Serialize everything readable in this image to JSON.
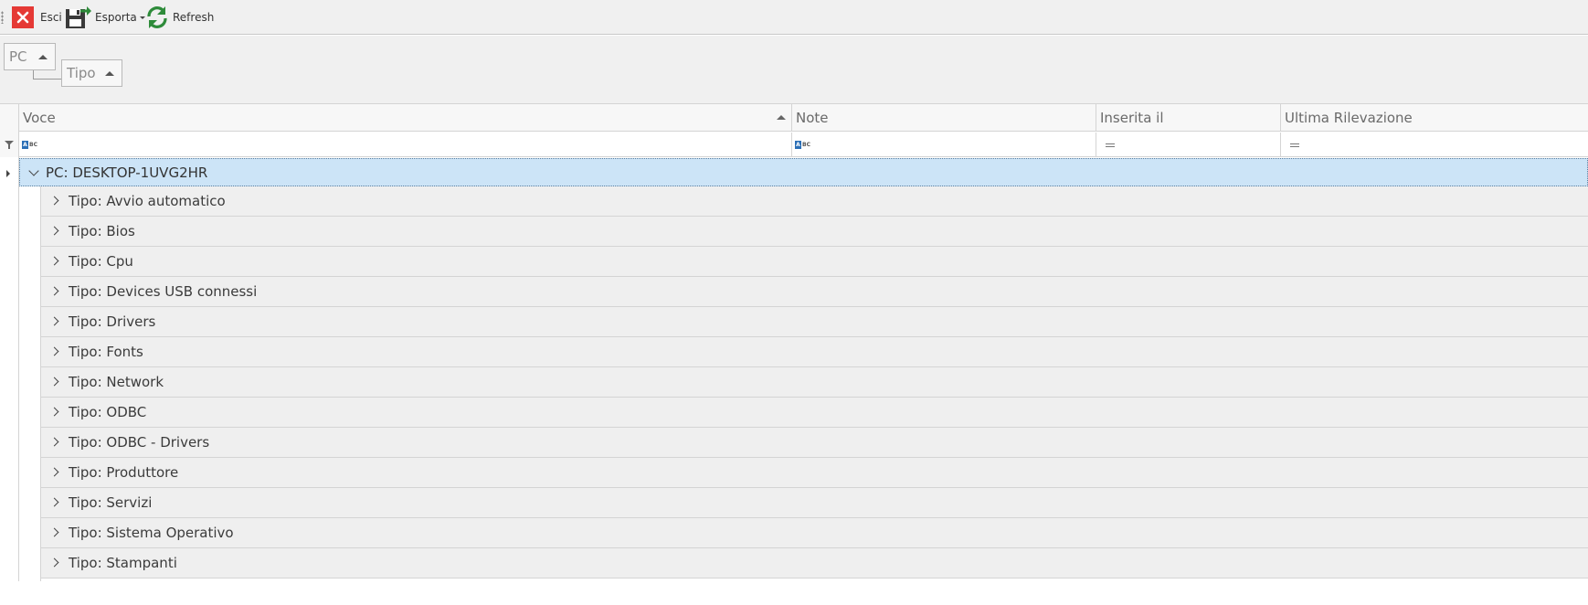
{
  "toolbar": {
    "exit_label": "Esci",
    "export_label": "Esporta",
    "refresh_label": "Refresh",
    "colors": {
      "exit_bg": "#e53935",
      "refresh": "#2e8b3a",
      "save": "#333333",
      "export_arrow": "#2e8b3a"
    }
  },
  "group_panel": {
    "chips": [
      "PC",
      "Tipo"
    ]
  },
  "grid": {
    "columns": [
      "Voce",
      "Note",
      "Inserita il",
      "Ultima Rilevazione"
    ],
    "sorted_column": "Voce",
    "filter_types": [
      "text",
      "text",
      "equals",
      "equals"
    ],
    "group_row": "PC: DESKTOP-1UVG2HR",
    "subgroups": [
      "Tipo: Avvio automatico",
      "Tipo: Bios",
      "Tipo: Cpu",
      "Tipo: Devices USB connessi",
      "Tipo: Drivers",
      "Tipo: Fonts",
      "Tipo: Network",
      "Tipo: ODBC",
      "Tipo: ODBC - Drivers",
      "Tipo: Produttore",
      "Tipo: Servizi",
      "Tipo: Sistema Operativo",
      "Tipo: Stampanti"
    ],
    "selection_color": "#cce4f7"
  }
}
